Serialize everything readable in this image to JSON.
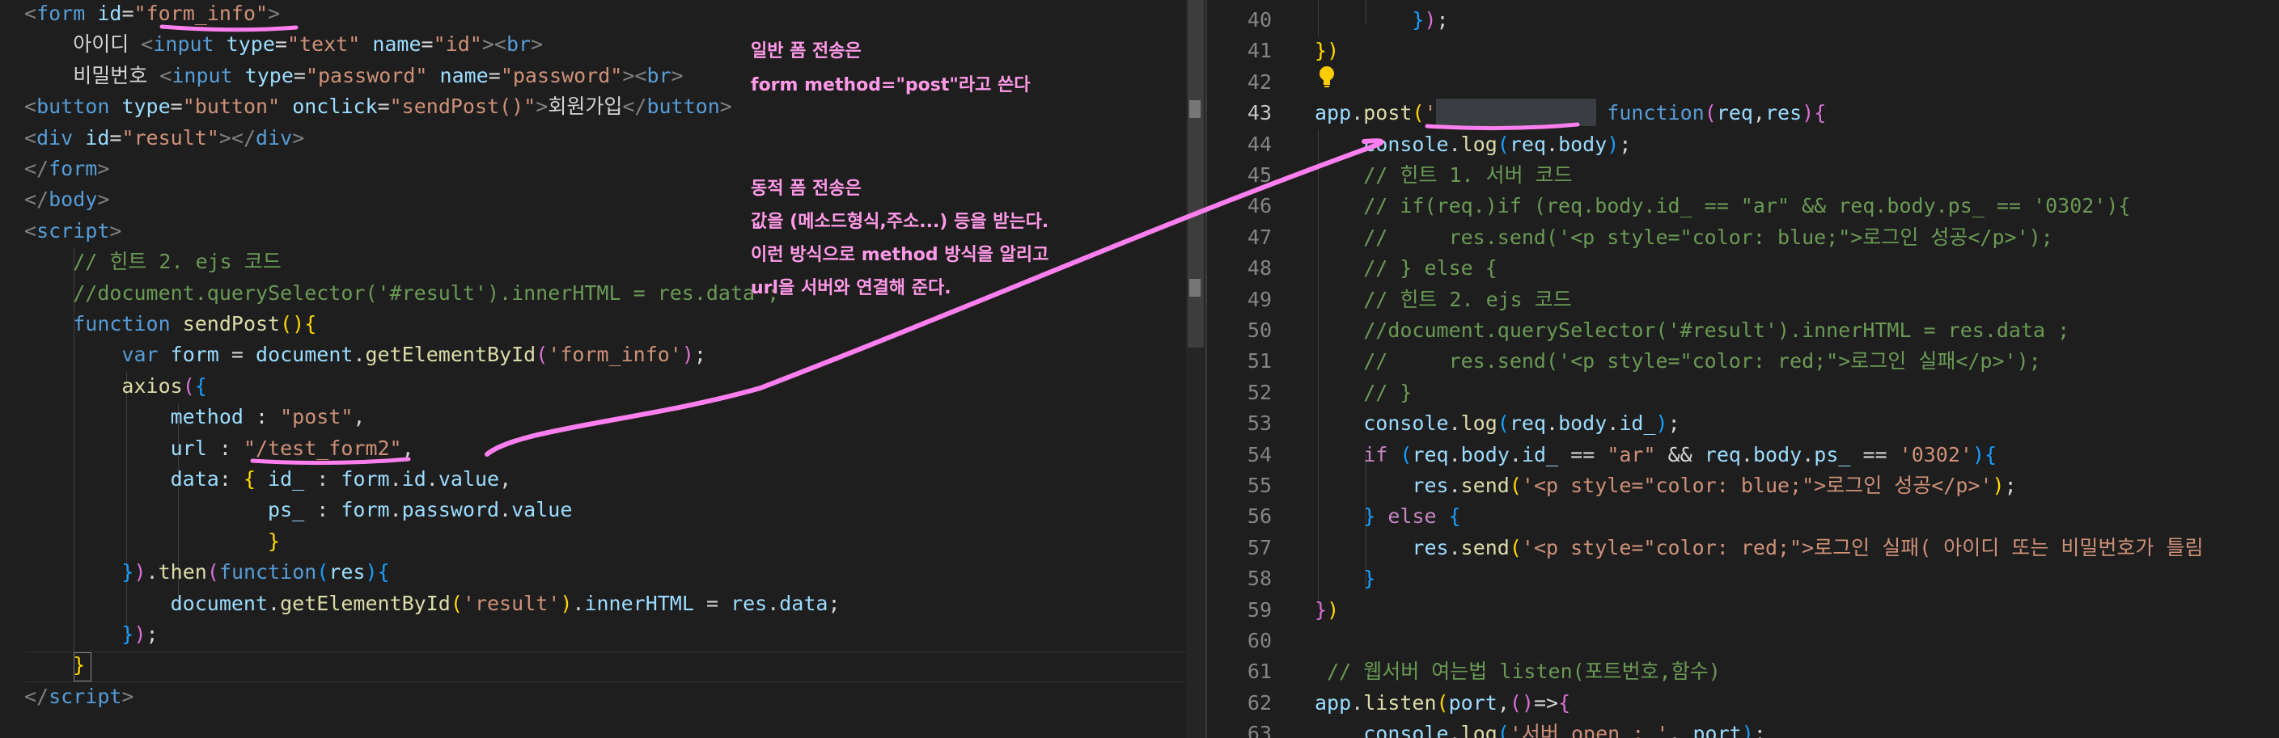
{
  "left_code": [
    {
      "n": "l1",
      "html": "<span class='t'>&lt;</span><span class='tag'>form</span> <span class='at'>id</span>=<span class='s'>\"form_info\"</span><span class='t'>&gt;</span>"
    },
    {
      "n": "l2",
      "html": "    <span class='txt'>아이디 </span><span class='t'>&lt;</span><span class='tag'>input</span> <span class='at'>type</span>=<span class='s'>\"text\"</span> <span class='at'>name</span>=<span class='s'>\"id\"</span><span class='t'>&gt;&lt;</span><span class='tag'>br</span><span class='t'>&gt;</span>"
    },
    {
      "n": "l3",
      "html": "    <span class='txt'>비밀번호 </span><span class='t'>&lt;</span><span class='tag'>input</span> <span class='at'>type</span>=<span class='s'>\"password\"</span> <span class='at'>name</span>=<span class='s'>\"password\"</span><span class='t'>&gt;&lt;</span><span class='tag'>br</span><span class='t'>&gt;</span>"
    },
    {
      "n": "l4",
      "html": "<span class='t'>&lt;</span><span class='tag'>button</span> <span class='at'>type</span>=<span class='s'>\"button\"</span> <span class='at'>onclick</span>=<span class='s'>\"sendPost()\"</span><span class='t'>&gt;</span><span class='txt'>회원가입</span><span class='t'>&lt;/</span><span class='tag'>button</span><span class='t'>&gt;</span>"
    },
    {
      "n": "l5",
      "html": "<span class='t'>&lt;</span><span class='tag'>div</span> <span class='at'>id</span>=<span class='s'>\"result\"</span><span class='t'>&gt;&lt;/</span><span class='tag'>div</span><span class='t'>&gt;</span>"
    },
    {
      "n": "l6",
      "html": "<span class='t'>&lt;/</span><span class='tag'>form</span><span class='t'>&gt;</span>"
    },
    {
      "n": "l7",
      "html": "<span class='t'>&lt;/</span><span class='tag'>body</span><span class='t'>&gt;</span>"
    },
    {
      "n": "l8",
      "html": "<span class='t'>&lt;</span><span class='tag'>script</span><span class='t'>&gt;</span>"
    },
    {
      "n": "l9",
      "html": "    <span class='c'>// 힌트 2. ejs 코드</span>"
    },
    {
      "n": "l10",
      "html": "    <span class='c'>//document.querySelector('#result').innerHTML = res.data ;</span>"
    },
    {
      "n": "l11",
      "html": "    <span class='k'>function</span> <span class='f'>sendPost</span><span class='b1'>()</span><span class='b1'>{</span>"
    },
    {
      "n": "l12",
      "html": "        <span class='k'>var</span> <span class='v'>form</span> = <span class='v'>document</span>.<span class='f'>getElementById</span><span class='b2'>(</span><span class='s'>'form_info'</span><span class='b2'>)</span>;"
    },
    {
      "n": "l13",
      "html": "        <span class='f'>axios</span><span class='b2'>(</span><span class='b3'>{</span>"
    },
    {
      "n": "l14",
      "html": "            <span class='pr'>method</span> : <span class='s'>\"post\"</span>,"
    },
    {
      "n": "l15",
      "html": "            <span class='pr'>url</span> : <span class='s'>\"/test_form2\"</span>,"
    },
    {
      "n": "l16",
      "html": "            <span class='pr'>data</span>: <span class='b1'>{</span> <span class='pr'>id_</span> : <span class='v'>form</span>.<span class='v'>id</span>.<span class='v'>value</span>,"
    },
    {
      "n": "l17",
      "html": "                    <span class='pr'>ps_</span> : <span class='v'>form</span>.<span class='v'>password</span>.<span class='v'>value</span>"
    },
    {
      "n": "l18",
      "html": "                    <span class='b1'>}</span>"
    },
    {
      "n": "l19",
      "html": "        <span class='b3'>}</span><span class='b2'>)</span>.<span class='f'>then</span><span class='b2'>(</span><span class='k'>function</span><span class='b3'>(</span><span class='v'>res</span><span class='b3'>)</span><span class='b3'>{</span>"
    },
    {
      "n": "l20",
      "html": "            <span class='v'>document</span>.<span class='f'>getElementById</span><span class='b1'>(</span><span class='s'>'result'</span><span class='b1'>)</span>.<span class='v'>innerHTML</span> = <span class='v'>res</span>.<span class='v'>data</span>;"
    },
    {
      "n": "l21",
      "html": "        <span class='b3'>}</span><span class='b2'>)</span>;"
    },
    {
      "n": "l22",
      "html": "    <span class='b1'>}</span>"
    },
    {
      "n": "l23",
      "html": "<span class='t'>&lt;/</span><span class='tag'>script</span><span class='t'>&gt;</span>"
    }
  ],
  "right_code": [
    {
      "num": "40",
      "html": "        <span class='b3'>}</span><span class='b2'>)</span>;"
    },
    {
      "num": "41",
      "html": "<span class='b1'>}</span><span class='b1'>)</span>"
    },
    {
      "num": "42",
      "html": ""
    },
    {
      "num": "43",
      "html": "<span class='v'>app</span>.<span class='f'>post</span><span class='b1'>(</span><span class='s'>'/test_form2'</span>, <span class='k'>function</span><span class='b2'>(</span><span class='v'>req</span>,<span class='v'>res</span><span class='b2'>)</span><span class='b2'>{</span>"
    },
    {
      "num": "44",
      "html": "    <span class='v'>console</span>.<span class='f'>log</span><span class='b3'>(</span><span class='v'>req</span>.<span class='v'>body</span><span class='b3'>)</span>;"
    },
    {
      "num": "45",
      "html": "    <span class='c'>// 힌트 1. 서버 코드</span>"
    },
    {
      "num": "46",
      "html": "    <span class='c'>// if(req.)if (req.body.id_ == \"ar\" &amp;&amp; req.body.ps_ == '0302'){</span>"
    },
    {
      "num": "47",
      "html": "    <span class='c'>//     res.send('&lt;p style=\"color: blue;\"&gt;로그인 성공&lt;/p&gt;');</span>"
    },
    {
      "num": "48",
      "html": "    <span class='c'>// } else {</span>"
    },
    {
      "num": "49",
      "html": "    <span class='c'>// 힌트 2. ejs 코드</span>"
    },
    {
      "num": "50",
      "html": "    <span class='c'>//document.querySelector('#result').innerHTML = res.data ;</span>"
    },
    {
      "num": "51",
      "html": "    <span class='c'>//     res.send('&lt;p style=\"color: red;\"&gt;로그인 실패&lt;/p&gt;');</span>"
    },
    {
      "num": "52",
      "html": "    <span class='c'>// }</span>"
    },
    {
      "num": "53",
      "html": "    <span class='v'>console</span>.<span class='f'>log</span><span class='b3'>(</span><span class='v'>req</span>.<span class='v'>body</span>.<span class='v'>id_</span><span class='b3'>)</span>;"
    },
    {
      "num": "54",
      "html": "    <span class='kc'>if</span> <span class='b3'>(</span><span class='v'>req</span>.<span class='v'>body</span>.<span class='v'>id_</span> == <span class='s'>\"ar\"</span> &amp;&amp; <span class='v'>req</span>.<span class='v'>body</span>.<span class='v'>ps_</span> == <span class='s'>'0302'</span><span class='b3'>)</span><span class='b3'>{</span>"
    },
    {
      "num": "55",
      "html": "        <span class='v'>res</span>.<span class='f'>send</span><span class='b1'>(</span><span class='s'>'&lt;p style=\"color: blue;\"&gt;</span><span class='s'>로그인 성공&lt;/p&gt;'</span><span class='b1'>)</span>;"
    },
    {
      "num": "56",
      "html": "    <span class='b3'>}</span> <span class='kc'>else</span> <span class='b3'>{</span>"
    },
    {
      "num": "57",
      "html": "        <span class='v'>res</span>.<span class='f'>send</span><span class='b1'>(</span><span class='s'>'&lt;p style=\"color: red;\"&gt;</span><span class='s'>로그인 실패( 아이디 또는 비밀번호가 틀림</span>"
    },
    {
      "num": "58",
      "html": "    <span class='b3'>}</span>"
    },
    {
      "num": "59",
      "html": "<span class='b2'>}</span><span class='b1'>)</span>"
    },
    {
      "num": "60",
      "html": ""
    },
    {
      "num": "61",
      "html": " <span class='c'>// 웹서버 여는법 listen(포트번호,함수)</span>"
    },
    {
      "num": "62",
      "html": "<span class='v'>app</span>.<span class='f'>listen</span><span class='b1'>(</span><span class='v'>port</span>,<span class='b2'>()</span>=&gt;<span class='b2'>{</span>"
    },
    {
      "num": "63",
      "html": "    <span class='v'>console</span>.<span class='f'>log</span><span class='b3'>(</span><span class='s'>'서버 open : '</span>, <span class='v'>port</span><span class='b3'>)</span>;"
    }
  ],
  "notes": {
    "n1": "일반 폼 전송은",
    "n2": "form method=\"post\"라고 쓴다",
    "n3": "동적 폼 전송은",
    "n4": "값을 (메소드형식,주소...) 등을 받는다.",
    "n5": "이런 방식으로 method 방식을 알리고",
    "n6": "url을 서버와 연결해 준다."
  },
  "colors": {
    "annotation_pink": "#ff7ff0",
    "editor_bg": "#1e1e1e"
  }
}
